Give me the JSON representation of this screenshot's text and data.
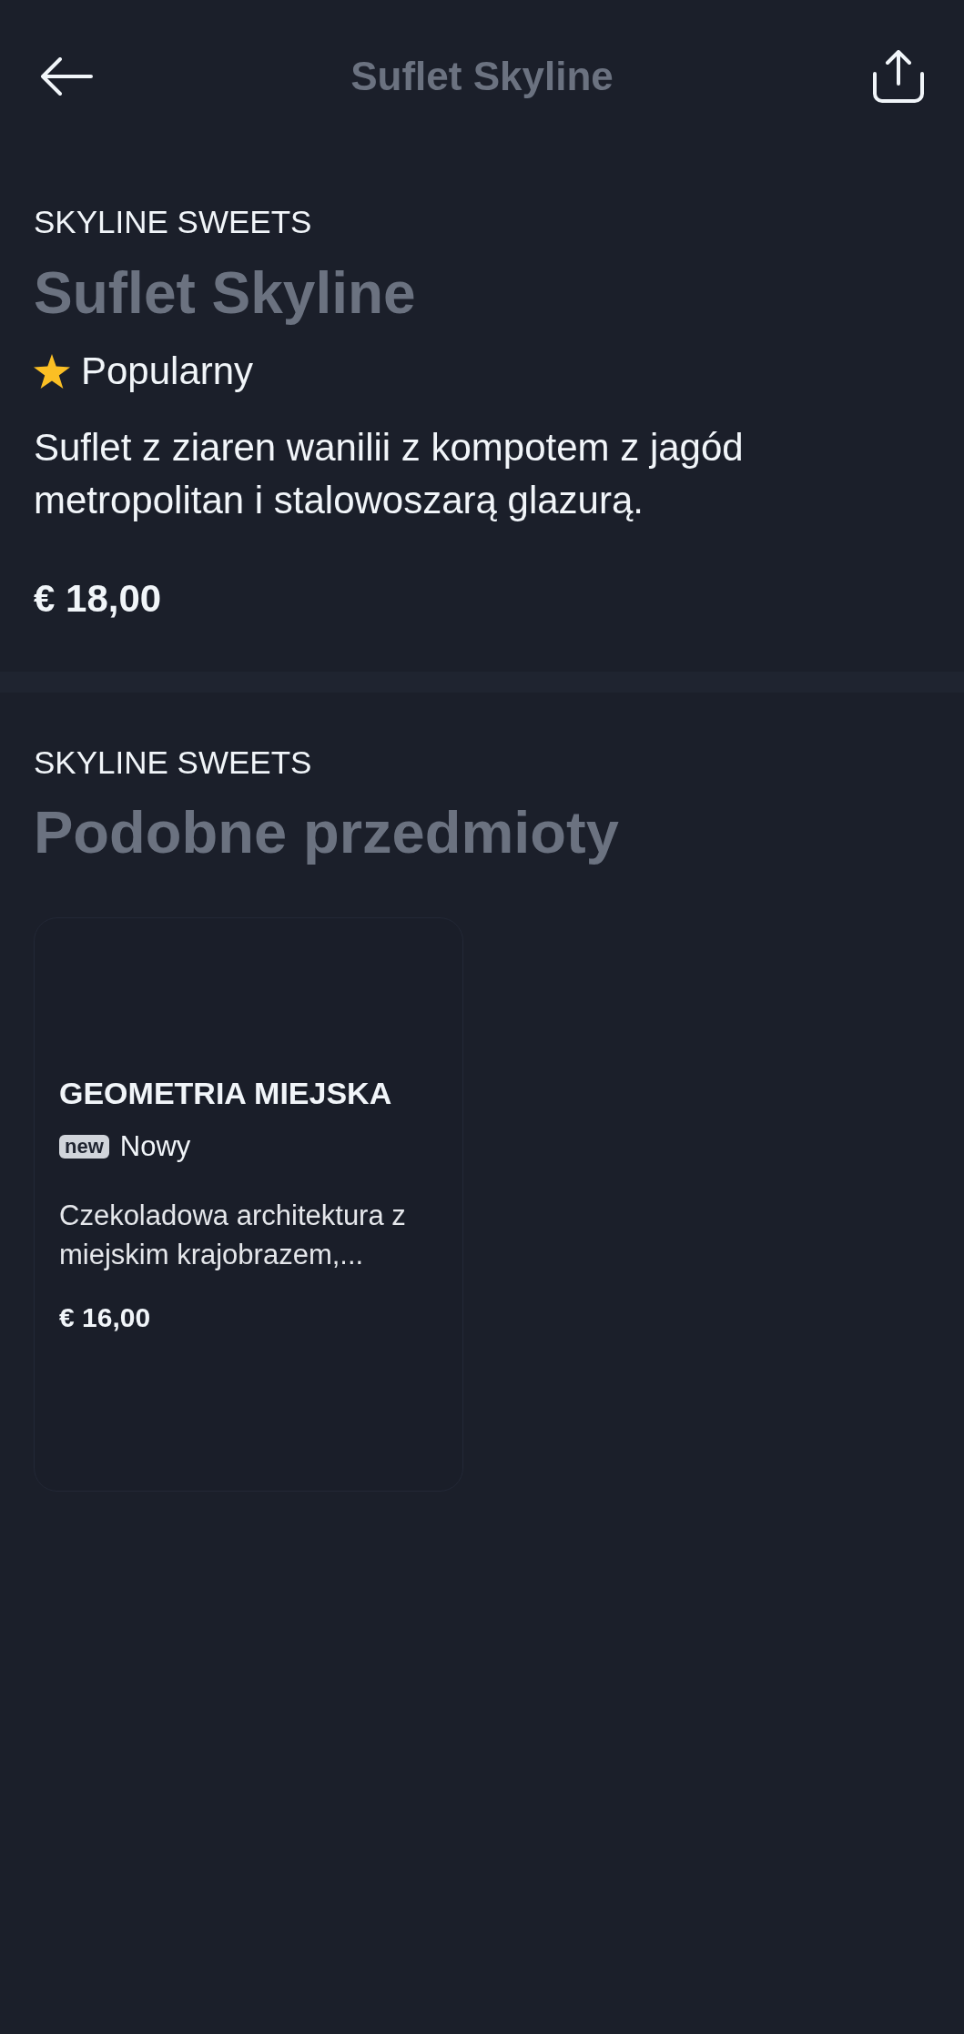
{
  "header": {
    "title": "Suflet Skyline"
  },
  "product": {
    "brand": "SKYLINE SWEETS",
    "name": "Suflet Skyline",
    "highlight": {
      "label": "Popularny"
    },
    "description": "Suflet z ziaren wanilii z kompotem z jagód metropolitan i stalowoszarą glazurą.",
    "price": "€ 18,00"
  },
  "similar": {
    "brand": "SKYLINE SWEETS",
    "title": "Podobne przedmioty",
    "items": [
      {
        "name": "GEOMETRIA MIEJSKA",
        "tag": "new",
        "tag_label": "Nowy",
        "description": "Czekoladowa architektura z miejskim krajobrazem,...",
        "price": "€ 16,00"
      }
    ]
  }
}
